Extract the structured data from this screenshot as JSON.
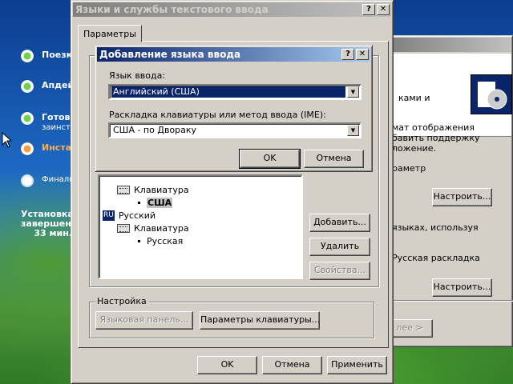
{
  "setup": {
    "steps": [
      {
        "label": "Поезка",
        "state": "done"
      },
      {
        "label": "Апдейт",
        "state": "done"
      },
      {
        "label": "Готовно",
        "label2": "заинст",
        "state": "done"
      },
      {
        "label": "Инста",
        "state": "current"
      },
      {
        "label": "Финали",
        "state": "todo"
      }
    ],
    "estimate_line1": "Установка",
    "estimate_line2": "завершена",
    "estimate_line3": "33 мин."
  },
  "bg_wizard": {
    "header_text": "ками и",
    "lines": [
      "мат отображения",
      "бавить поддержку",
      "ложение.",
      "раметр",
      "языках, используя",
      "Русская раскладка",
      "лее >"
    ],
    "customize_button_1": "Настроить...",
    "customize_button_2": "Настроить..."
  },
  "main_dialog": {
    "title": "Языки и службы текстового ввода",
    "help_btn": "?",
    "close_btn": "✕",
    "tab_label": "Параметры",
    "tree": {
      "kbd1": "Клавиатура",
      "item1": "США",
      "lang2_code": "RU",
      "lang2": "Русский",
      "kbd2": "Клавиатура",
      "item2": "Русская"
    },
    "add_button": "Добавить...",
    "remove_button": "Удалить",
    "properties_button": "Свойства...",
    "settings_group": "Настройка",
    "language_bar_button": "Языковая панель...",
    "key_settings_button": "Параметры клавиатуры...",
    "ok_button": "OK",
    "cancel_button": "Отмена",
    "apply_button": "Применить"
  },
  "add_dialog": {
    "title": "Добавление языка ввода",
    "help_btn": "?",
    "close_btn": "✕",
    "input_lang_label": "Язык ввода:",
    "input_lang_value": "Английский (США)",
    "layout_label": "Раскладка клавиатуры или метод ввода (IME):",
    "layout_value": "США - по Двораку",
    "ok_button": "OK",
    "cancel_button": "Отмена"
  },
  "colors": {
    "active_title": "#0a246a",
    "selection": "#0a246a",
    "face": "#d4d0c8"
  }
}
